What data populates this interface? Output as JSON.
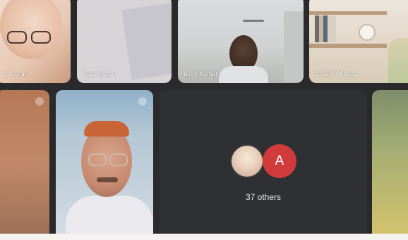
{
  "participants": [
    {
      "name": "..t Keshri"
    },
    {
      "name": "Ajay Kumar"
    },
    {
      "name": "Bijay Kumar"
    },
    {
      "name": "GSGO St Mera"
    }
  ],
  "overflow": {
    "avatar_letter": "A",
    "label": "37 others"
  },
  "colors": {
    "avatar_red": "#d23b3b",
    "tile_dark": "#2f3033"
  }
}
